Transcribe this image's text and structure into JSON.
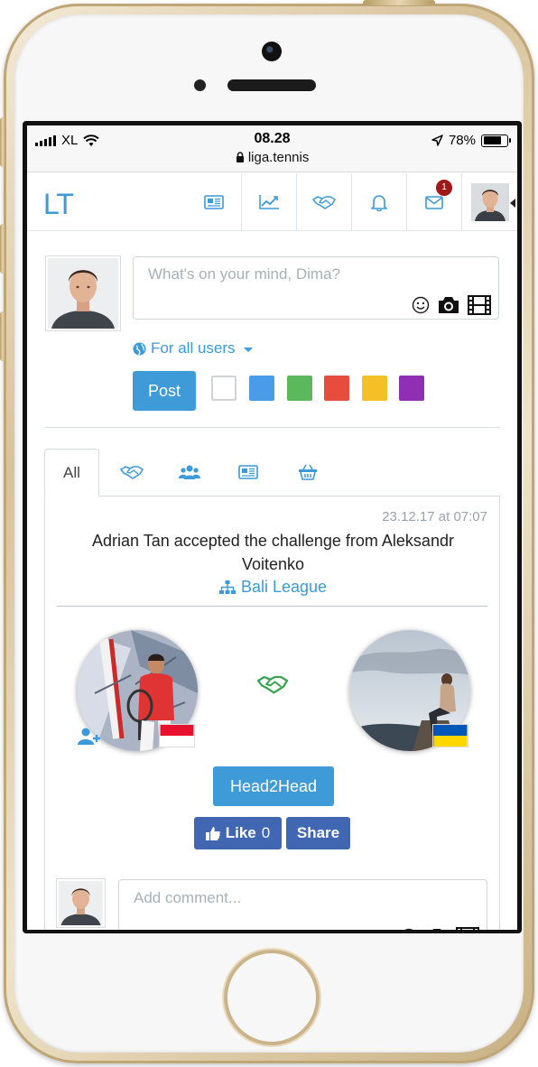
{
  "status_bar": {
    "carrier": "XL",
    "time": "08.28",
    "url": "liga.tennis",
    "battery": "78%",
    "battery_level": 0.78
  },
  "nav": {
    "logo": "LT",
    "items": [
      {
        "icon": "newspaper-icon"
      },
      {
        "icon": "trending-chart-icon"
      },
      {
        "icon": "handshake-icon"
      },
      {
        "icon": "bell-icon"
      },
      {
        "icon": "envelope-icon",
        "badge": "1"
      },
      {
        "icon": "user-avatar"
      }
    ]
  },
  "composer": {
    "placeholder": "What's on your mind, Dima?",
    "visibility": "For all users",
    "post_label": "Post",
    "colors": [
      "#ffffff",
      "#4a9be8",
      "#5cb85c",
      "#e74c3c",
      "#f5c027",
      "#8e2fb4"
    ]
  },
  "tabs": [
    {
      "label": "All",
      "active": true
    },
    {
      "icon": "handshake-icon"
    },
    {
      "icon": "users-group-icon"
    },
    {
      "icon": "newspaper-icon"
    },
    {
      "icon": "basket-icon"
    }
  ],
  "feed_item": {
    "timestamp": "23.12.17 at 07:07",
    "title": "Adrian Tan accepted the challenge from Aleksandr Voitenko",
    "league": "Bali League",
    "h2h_label": "Head2Head",
    "like_label": "Like",
    "like_count": "0",
    "share_label": "Share",
    "players": [
      {
        "flag": "Indonesia"
      },
      {
        "flag": "Ukraine"
      }
    ]
  },
  "comment": {
    "placeholder": "Add comment..."
  }
}
